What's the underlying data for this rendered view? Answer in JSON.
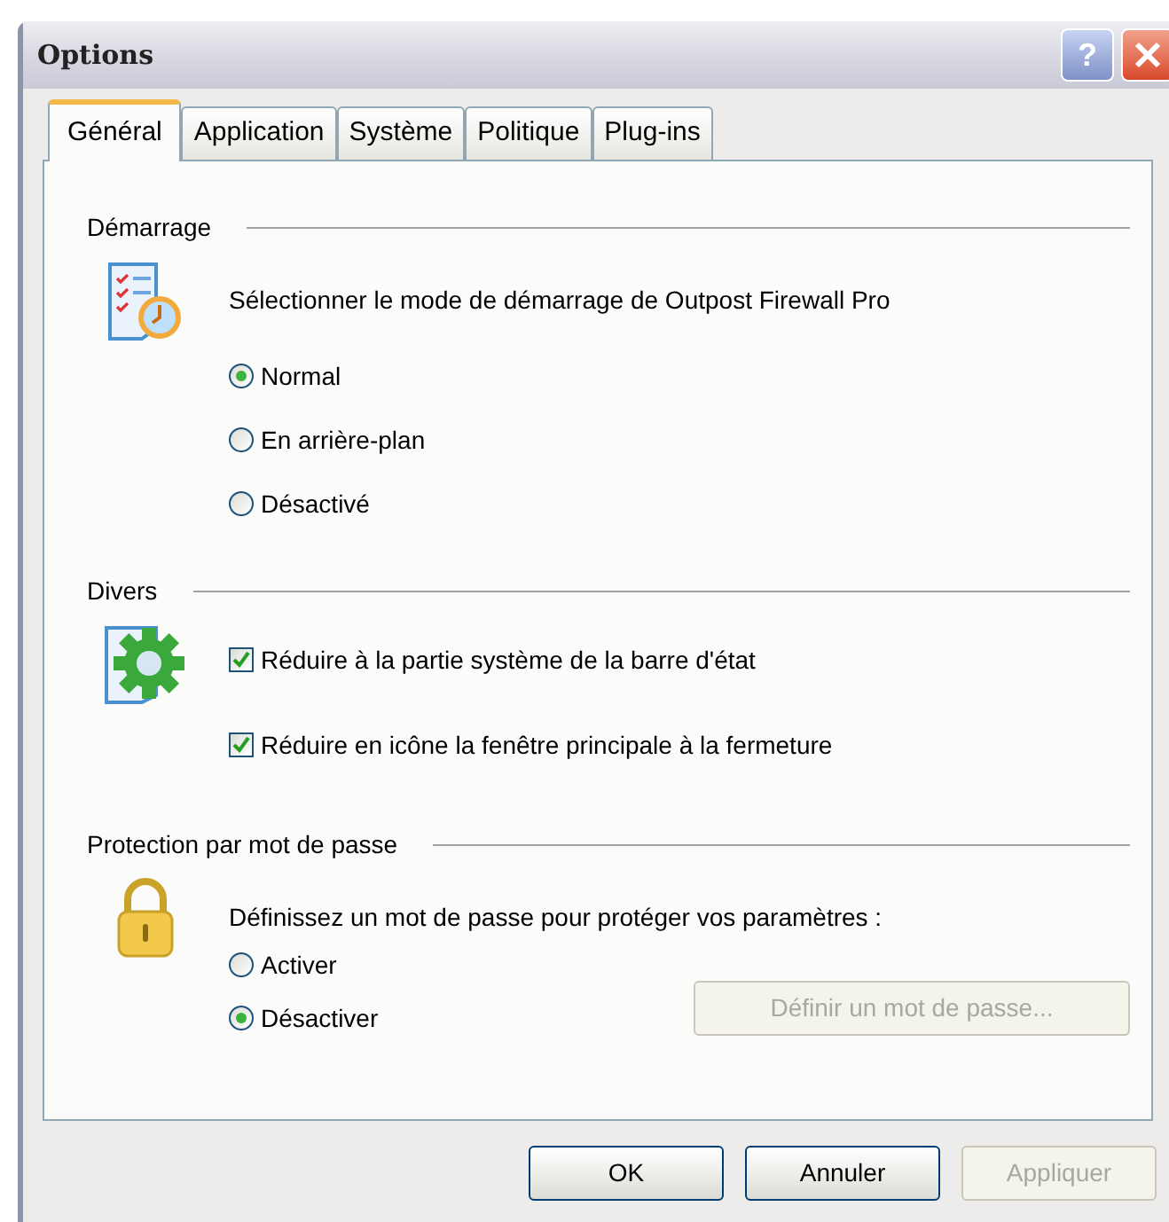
{
  "window": {
    "title": "Options",
    "help_button": "?"
  },
  "tabs": [
    {
      "label": "Général",
      "selected": true
    },
    {
      "label": "Application",
      "selected": false
    },
    {
      "label": "Système",
      "selected": false
    },
    {
      "label": "Politique",
      "selected": false
    },
    {
      "label": "Plug-ins",
      "selected": false
    }
  ],
  "sections": [
    {
      "title": "Démarrage",
      "description": "Sélectionner le mode de démarrage de Outpost Firewall Pro",
      "items": [
        {
          "kind": "radio",
          "label": "Normal",
          "selected": true
        },
        {
          "kind": "radio",
          "label": "En arrière-plan",
          "selected": false
        },
        {
          "kind": "radio",
          "label": "Désactivé",
          "selected": false
        }
      ]
    },
    {
      "title": "Divers",
      "items": [
        {
          "kind": "checkbox",
          "label": "Réduire à la partie système de la barre d'état",
          "checked": true
        },
        {
          "kind": "checkbox",
          "label": "Réduire en icône la fenêtre principale à la fermeture",
          "checked": true
        }
      ]
    },
    {
      "title": "Protection par mot de passe",
      "description": "Définissez un mot de passe pour protéger vos paramètres :",
      "items": [
        {
          "kind": "radio",
          "label": "Activer",
          "selected": false
        },
        {
          "kind": "radio",
          "label": "Désactiver",
          "selected": true
        }
      ],
      "button": {
        "label": "Définir un mot de passe...",
        "disabled": true
      }
    }
  ],
  "buttons": [
    {
      "label": "OK",
      "disabled": false
    },
    {
      "label": "Annuler",
      "disabled": false
    },
    {
      "label": "Appliquer",
      "disabled": true
    }
  ]
}
